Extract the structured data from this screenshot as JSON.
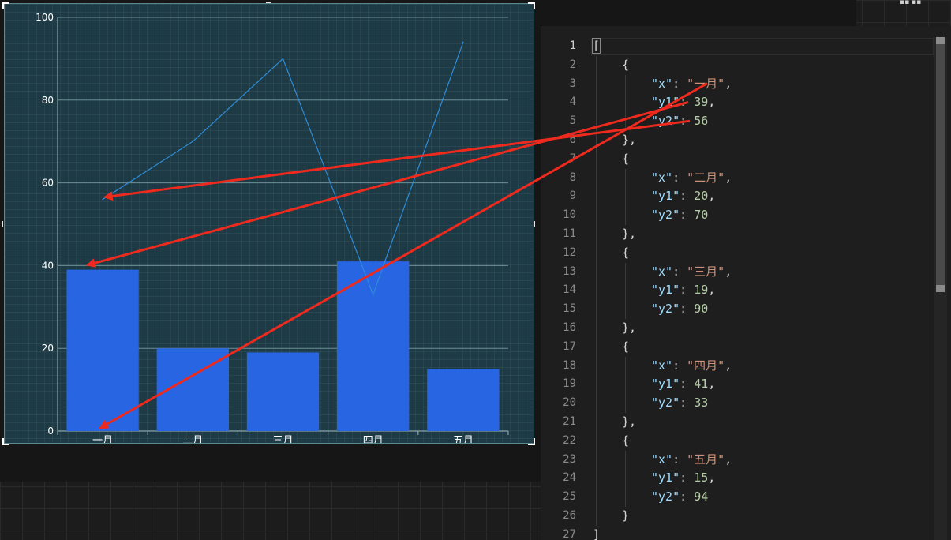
{
  "chart_data": {
    "type": "bar",
    "categories": [
      "一月",
      "二月",
      "三月",
      "四月",
      "五月"
    ],
    "series": [
      {
        "key": "y1",
        "type": "bar",
        "values": [
          39,
          20,
          19,
          41,
          15
        ],
        "color": "#2865e3"
      },
      {
        "key": "y2",
        "type": "line",
        "values": [
          56,
          70,
          90,
          33,
          94
        ],
        "color": "#2f8cd8"
      }
    ],
    "ylim": [
      0,
      100
    ],
    "yticks": [
      0,
      20,
      40,
      60,
      80,
      100
    ],
    "grid": true,
    "colors": {
      "background": "#1d3a45",
      "axis": "#9fb7bd",
      "gridline": "#6f8f96",
      "tick_text": "#ffffff"
    }
  },
  "editor": {
    "lines": [
      [
        [
          "pun",
          "["
        ]
      ],
      [
        [
          "pun",
          "{"
        ]
      ],
      [
        [
          "key",
          "\"x\""
        ],
        [
          "pun",
          ": "
        ],
        [
          "str",
          "\"一月\""
        ],
        [
          "pun",
          ","
        ]
      ],
      [
        [
          "key",
          "\"y1\""
        ],
        [
          "pun",
          ": "
        ],
        [
          "num",
          "39"
        ],
        [
          "pun",
          ","
        ]
      ],
      [
        [
          "key",
          "\"y2\""
        ],
        [
          "pun",
          ": "
        ],
        [
          "num",
          "56"
        ]
      ],
      [
        [
          "pun",
          "},"
        ]
      ],
      [
        [
          "pun",
          "{"
        ]
      ],
      [
        [
          "key",
          "\"x\""
        ],
        [
          "pun",
          ": "
        ],
        [
          "str",
          "\"二月\""
        ],
        [
          "pun",
          ","
        ]
      ],
      [
        [
          "key",
          "\"y1\""
        ],
        [
          "pun",
          ": "
        ],
        [
          "num",
          "20"
        ],
        [
          "pun",
          ","
        ]
      ],
      [
        [
          "key",
          "\"y2\""
        ],
        [
          "pun",
          ": "
        ],
        [
          "num",
          "70"
        ]
      ],
      [
        [
          "pun",
          "},"
        ]
      ],
      [
        [
          "pun",
          "{"
        ]
      ],
      [
        [
          "key",
          "\"x\""
        ],
        [
          "pun",
          ": "
        ],
        [
          "str",
          "\"三月\""
        ],
        [
          "pun",
          ","
        ]
      ],
      [
        [
          "key",
          "\"y1\""
        ],
        [
          "pun",
          ": "
        ],
        [
          "num",
          "19"
        ],
        [
          "pun",
          ","
        ]
      ],
      [
        [
          "key",
          "\"y2\""
        ],
        [
          "pun",
          ": "
        ],
        [
          "num",
          "90"
        ]
      ],
      [
        [
          "pun",
          "},"
        ]
      ],
      [
        [
          "pun",
          "{"
        ]
      ],
      [
        [
          "key",
          "\"x\""
        ],
        [
          "pun",
          ": "
        ],
        [
          "str",
          "\"四月\""
        ],
        [
          "pun",
          ","
        ]
      ],
      [
        [
          "key",
          "\"y1\""
        ],
        [
          "pun",
          ": "
        ],
        [
          "num",
          "41"
        ],
        [
          "pun",
          ","
        ]
      ],
      [
        [
          "key",
          "\"y2\""
        ],
        [
          "pun",
          ": "
        ],
        [
          "num",
          "33"
        ]
      ],
      [
        [
          "pun",
          "},"
        ]
      ],
      [
        [
          "pun",
          "{"
        ]
      ],
      [
        [
          "key",
          "\"x\""
        ],
        [
          "pun",
          ": "
        ],
        [
          "str",
          "\"五月\""
        ],
        [
          "pun",
          ","
        ]
      ],
      [
        [
          "key",
          "\"y1\""
        ],
        [
          "pun",
          ": "
        ],
        [
          "num",
          "15"
        ],
        [
          "pun",
          ","
        ]
      ],
      [
        [
          "key",
          "\"y2\""
        ],
        [
          "pun",
          ": "
        ],
        [
          "num",
          "94"
        ]
      ],
      [
        [
          "pun",
          "}"
        ]
      ],
      [
        [
          "pun",
          "]"
        ]
      ]
    ],
    "indent_levels": [
      0,
      1,
      2,
      2,
      2,
      1,
      1,
      2,
      2,
      2,
      1,
      1,
      2,
      2,
      2,
      1,
      1,
      2,
      2,
      2,
      1,
      1,
      2,
      2,
      2,
      1,
      0
    ],
    "active_line": 1,
    "colors": {
      "key": "#9cdcfe",
      "string": "#ce9178",
      "number": "#b5cea8",
      "punctuation": "#d4d4d4"
    }
  },
  "annotations": {
    "color": "#ee2a1e",
    "arrows": [
      {
        "from": "editor.lines.4",
        "to": "chart_data.series.1.values.0"
      },
      {
        "from": "editor.lines.3",
        "to": "chart_data.series.0.values.0"
      },
      {
        "from": "editor.lines.2",
        "to": "chart_data.categories.0"
      }
    ]
  },
  "window": {
    "top_right_mark": "▪▪ ▪▪"
  }
}
